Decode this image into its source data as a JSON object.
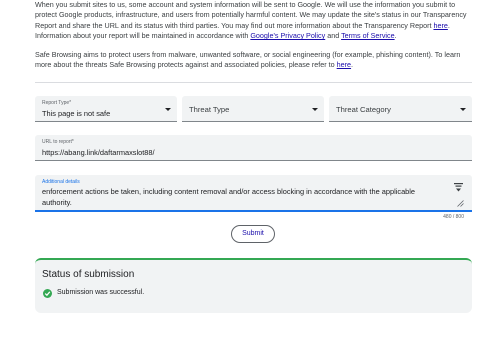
{
  "intro": {
    "p1_a": "When you submit sites to us, some account and system information will be sent to Google. We will use the information you submit to protect Google products, infrastructure, and users from potentially harmful content. We may update the site's status in our Transparency Report and share the URL and its status with third parties. You may find out more information about the Transparency Report ",
    "p1_link_here": "here",
    "p1_b": ". Information about your report will be maintained in accordance with ",
    "p1_link_privacy": "Google's Privacy Policy",
    "p1_c": " and ",
    "p1_link_terms": "Terms of Service",
    "p1_d": ".",
    "p2_a": "Safe Browsing aims to protect users from malware, unwanted software, or social engineering (for example, phishing content). To learn more about the threats Safe Browsing protects against and associated policies, please refer to ",
    "p2_link_here": "here",
    "p2_b": "."
  },
  "form": {
    "report_type": {
      "label": "Report Type*",
      "value": "This page is not safe"
    },
    "threat_type": {
      "placeholder": "Threat Type"
    },
    "threat_category": {
      "placeholder": "Threat Category"
    },
    "url": {
      "label": "URL to report*",
      "value": "https://abang.link/daftarmaxslot88/"
    },
    "details": {
      "label": "Additional details",
      "value": "enforcement actions be taken, including content removal and/or access blocking in accordance with the applicable authority."
    },
    "char_counter": "480 / 800",
    "submit_label": "Submit"
  },
  "status": {
    "title": "Status of submission",
    "message": "Submission was successful.",
    "success_color": "#34a853"
  }
}
